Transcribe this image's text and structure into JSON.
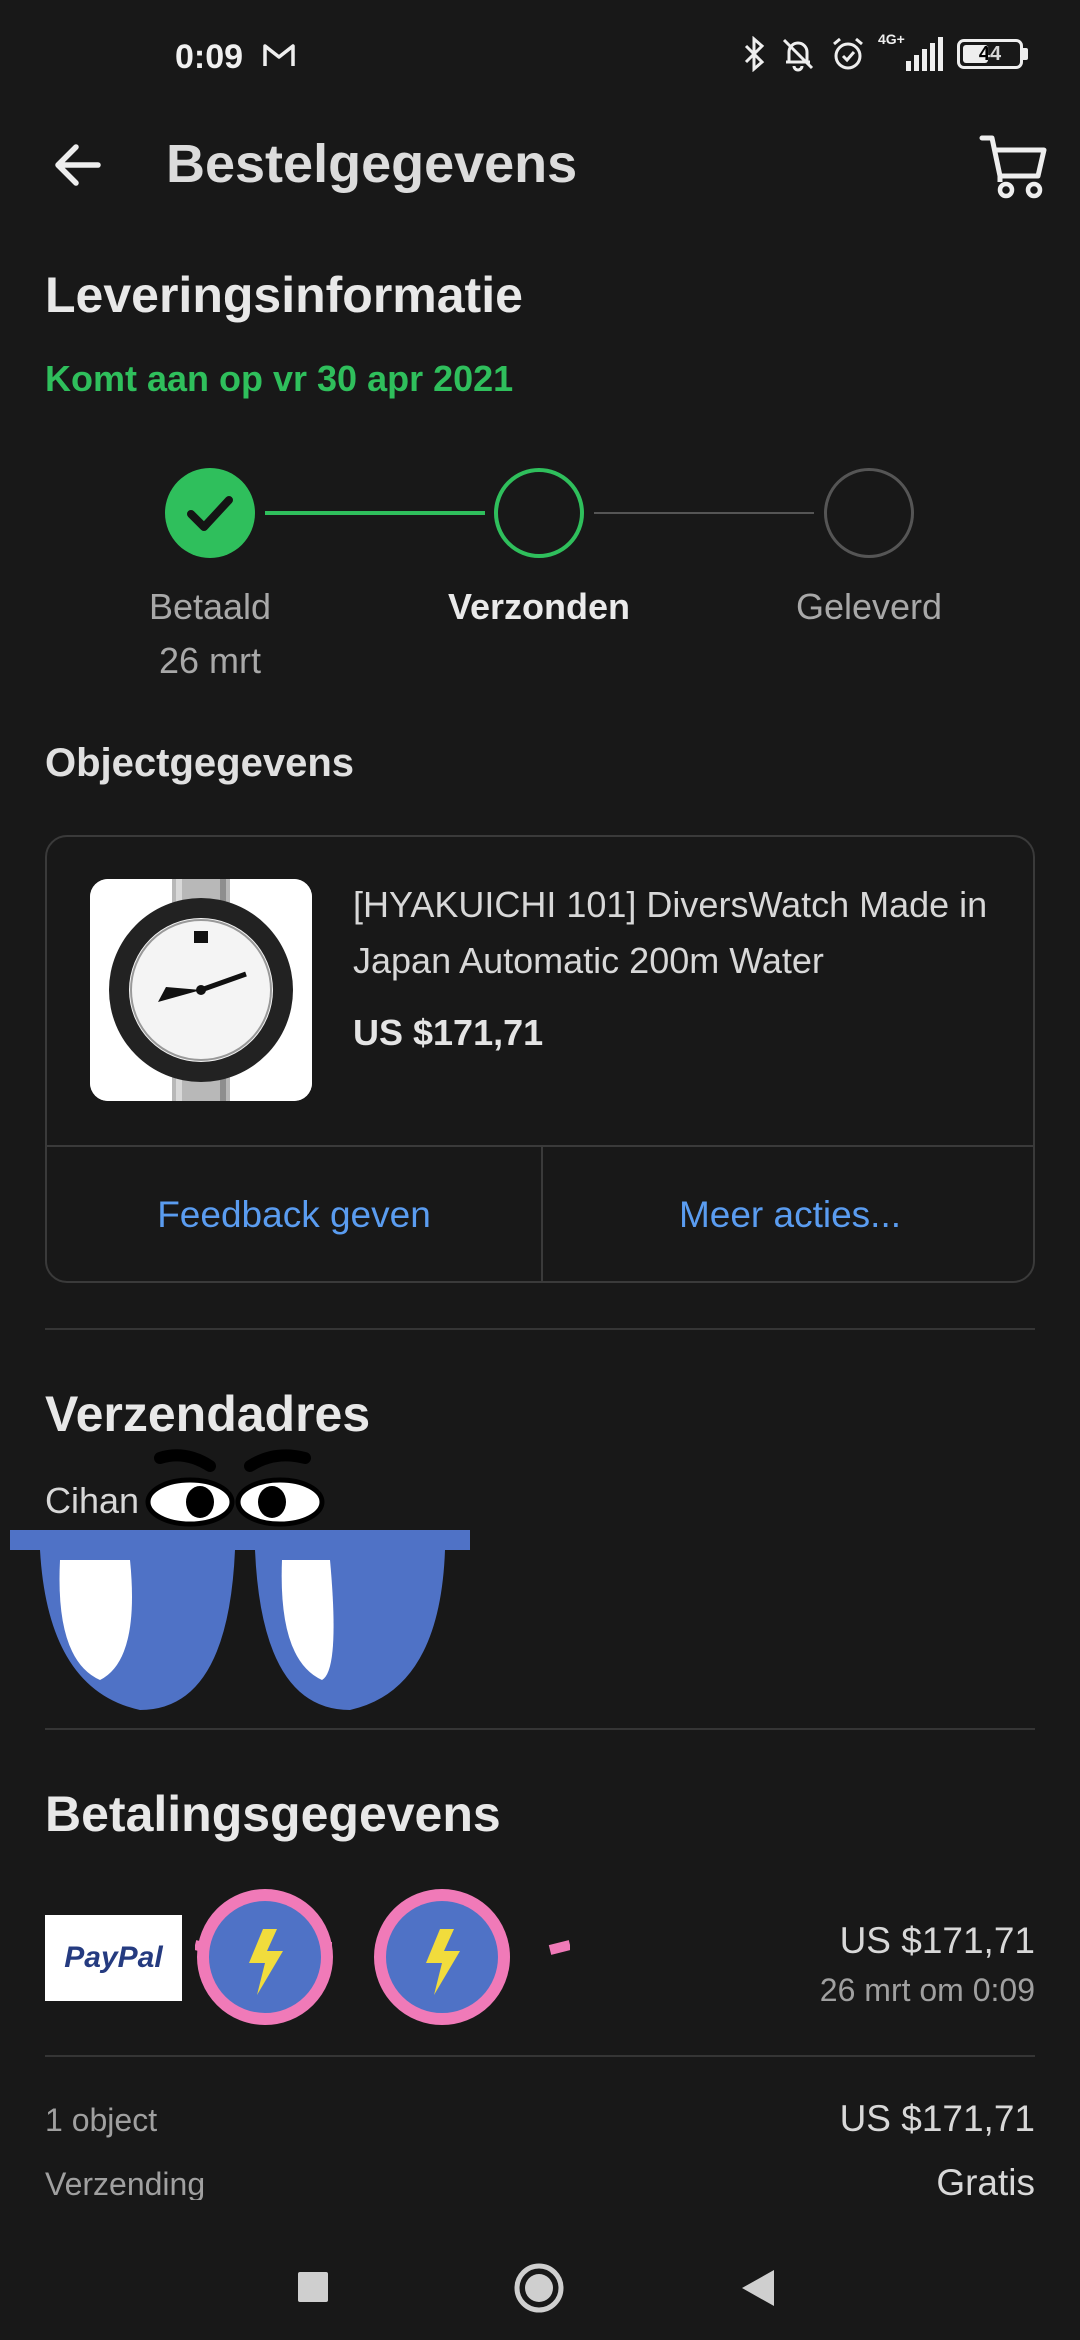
{
  "status_bar": {
    "time": "0:09",
    "network": "4G+",
    "battery": "44"
  },
  "app_bar": {
    "title": "Bestelgegevens"
  },
  "delivery": {
    "heading": "Leveringsinformatie",
    "arrival": "Komt aan op vr 30 apr 2021",
    "steps": [
      {
        "label": "Betaald",
        "date": "26 mrt",
        "state": "done"
      },
      {
        "label": "Verzonden",
        "date": "",
        "state": "current"
      },
      {
        "label": "Geleverd",
        "date": "",
        "state": "pending"
      }
    ]
  },
  "object": {
    "heading": "Objectgegevens",
    "title": "[HYAKUICHI 101] DiversWatch Made in Japan Automatic 200m Water",
    "price": "US $171,71",
    "feedback_label": "Feedback geven",
    "more_label": "Meer acties..."
  },
  "shipping": {
    "heading": "Verzendadres",
    "name_visible": "Cihan"
  },
  "payment": {
    "heading": "Betalingsgegevens",
    "method_logo": "PayPal",
    "amount": "US $171,71",
    "date": "26 mrt om 0:09"
  },
  "summary": {
    "items_label": "1 object",
    "items_value": "US $171,71",
    "shipping_label": "Verzending",
    "shipping_value": "Gratis"
  },
  "colors": {
    "background": "#181818",
    "accent_green": "#2fbf5c",
    "link_blue": "#5a9cf0"
  }
}
